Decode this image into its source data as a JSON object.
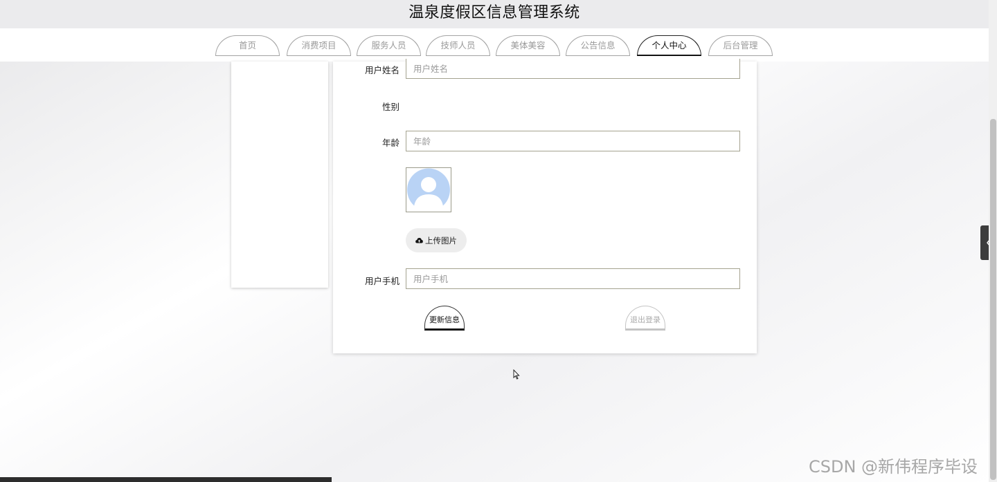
{
  "header": {
    "title": "温泉度假区信息管理系统"
  },
  "nav": {
    "tabs": [
      {
        "label": "首页",
        "active": false
      },
      {
        "label": "消费项目",
        "active": false
      },
      {
        "label": "服务人员",
        "active": false
      },
      {
        "label": "技师人员",
        "active": false
      },
      {
        "label": "美体美容",
        "active": false
      },
      {
        "label": "公告信息",
        "active": false
      },
      {
        "label": "个人中心",
        "active": true
      },
      {
        "label": "后台管理",
        "active": false
      }
    ]
  },
  "form": {
    "name": {
      "label": "用户姓名",
      "placeholder": "用户姓名"
    },
    "gender": {
      "label": "性别"
    },
    "age": {
      "label": "年龄",
      "placeholder": "年龄"
    },
    "upload_label": "上传图片",
    "phone": {
      "label": "用户手机",
      "placeholder": "用户手机"
    },
    "update_button": "更新信息",
    "logout_button": "退出登录"
  },
  "watermark": "CSDN @新伟程序毕设",
  "colors": {
    "accent": "#111111",
    "field_border": "#a4a28f",
    "avatar": "#b9d3f5"
  }
}
